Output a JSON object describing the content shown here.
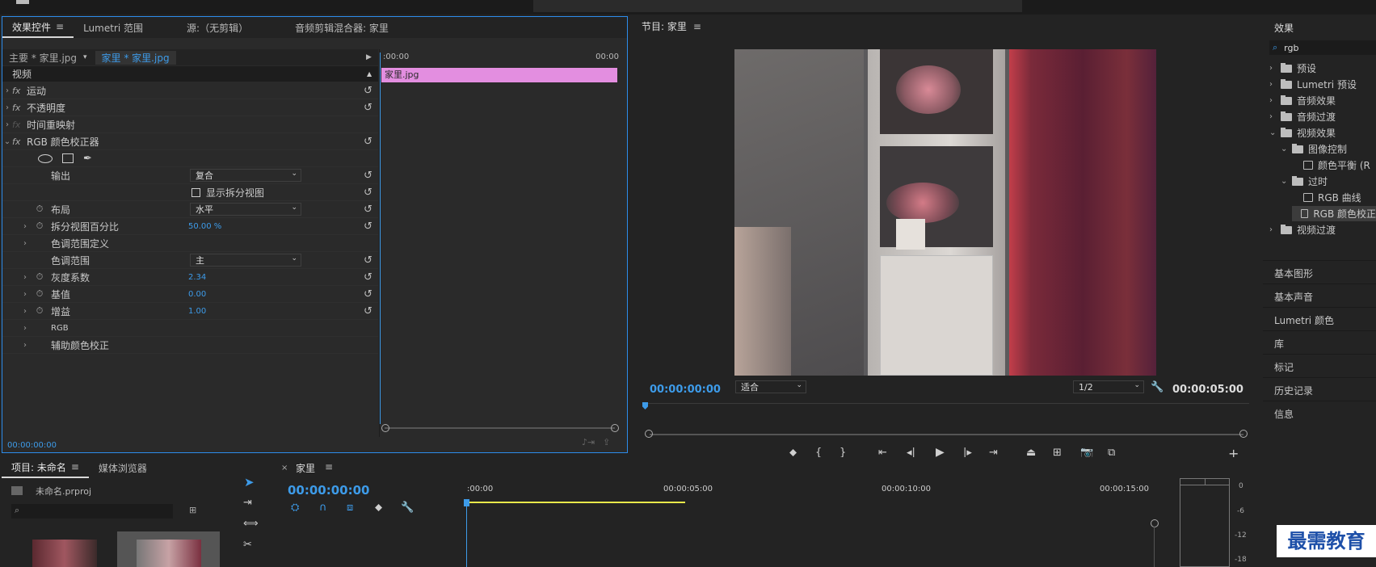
{
  "effect_controls": {
    "tabs": [
      "效果控件",
      "Lumetri 范围",
      "源:（无剪辑）",
      "音频剪辑混合器: 家里"
    ],
    "master_label": "主要 * 家里.jpg",
    "clip_label": "家里 * 家里.jpg",
    "time_start": ":00:00",
    "time_end": "00:00",
    "clip_bar": "家里.jpg",
    "section_video": "视频",
    "effects": [
      {
        "label": "运动",
        "fx": "fx"
      },
      {
        "label": "不透明度",
        "fx": "fx"
      },
      {
        "label": "时间重映射",
        "fx": "fx"
      },
      {
        "label": "RGB 颜色校正器",
        "fx": "fx"
      }
    ],
    "output_label": "输出",
    "output_value": "复合",
    "split_view_checkbox": "显示拆分视图",
    "layout_label": "布局",
    "layout_value": "水平",
    "split_percent_label": "拆分视图百分比",
    "split_percent_value": "50.00 %",
    "tone_range_def": "色调范围定义",
    "tone_range_label": "色调范围",
    "tone_range_value": "主",
    "gamma_label": "灰度系数",
    "gamma_value": "2.34",
    "pedestal_label": "基值",
    "pedestal_value": "0.00",
    "gain_label": "增益",
    "gain_value": "1.00",
    "rgb_label": "RGB",
    "secondary_label": "辅助颜色校正",
    "bottom_time": "00:00:00:00"
  },
  "program_monitor": {
    "title": "节目: 家里",
    "timecode": "00:00:00:00",
    "fit_value": "适合",
    "resolution": "1/2",
    "duration": "00:00:05:00"
  },
  "effects_panel": {
    "title": "效果",
    "search_value": "rgb",
    "tree": [
      {
        "label": "预设",
        "level": 0,
        "kind": "folder",
        "open": false
      },
      {
        "label": "Lumetri 预设",
        "level": 0,
        "kind": "folder",
        "open": false
      },
      {
        "label": "音频效果",
        "level": 0,
        "kind": "folder",
        "open": false
      },
      {
        "label": "音频过渡",
        "level": 0,
        "kind": "folder",
        "open": false
      },
      {
        "label": "视频效果",
        "level": 0,
        "kind": "folder",
        "open": true
      },
      {
        "label": "图像控制",
        "level": 1,
        "kind": "folder",
        "open": true
      },
      {
        "label": "颜色平衡 (R",
        "level": 2,
        "kind": "fx",
        "open": false
      },
      {
        "label": "过时",
        "level": 1,
        "kind": "folder",
        "open": true
      },
      {
        "label": "RGB 曲线",
        "level": 2,
        "kind": "fx",
        "open": false
      },
      {
        "label": "RGB 颜色校正",
        "level": 2,
        "kind": "fx",
        "open": false
      },
      {
        "label": "视频过渡",
        "level": 0,
        "kind": "folder",
        "open": false
      }
    ],
    "sections": [
      "基本图形",
      "基本声音",
      "Lumetri 颜色",
      "库",
      "标记",
      "历史记录",
      "信息"
    ]
  },
  "project": {
    "tabs": [
      "项目: 未命名",
      "媒体浏览器"
    ],
    "file": "未命名.prproj"
  },
  "timeline": {
    "title": "家里",
    "timecode": "00:00:00:00",
    "ruler": [
      ":00:00",
      "00:00:05:00",
      "00:00:10:00",
      "00:00:15:00"
    ]
  },
  "audio_meter": {
    "labels": [
      "0",
      "-6",
      "-12",
      "-18"
    ]
  },
  "watermark": "最需教育",
  "colors": {
    "accent": "#3d9be9",
    "clip": "#e38ee0",
    "timeline_bar": "#e8e84a"
  }
}
